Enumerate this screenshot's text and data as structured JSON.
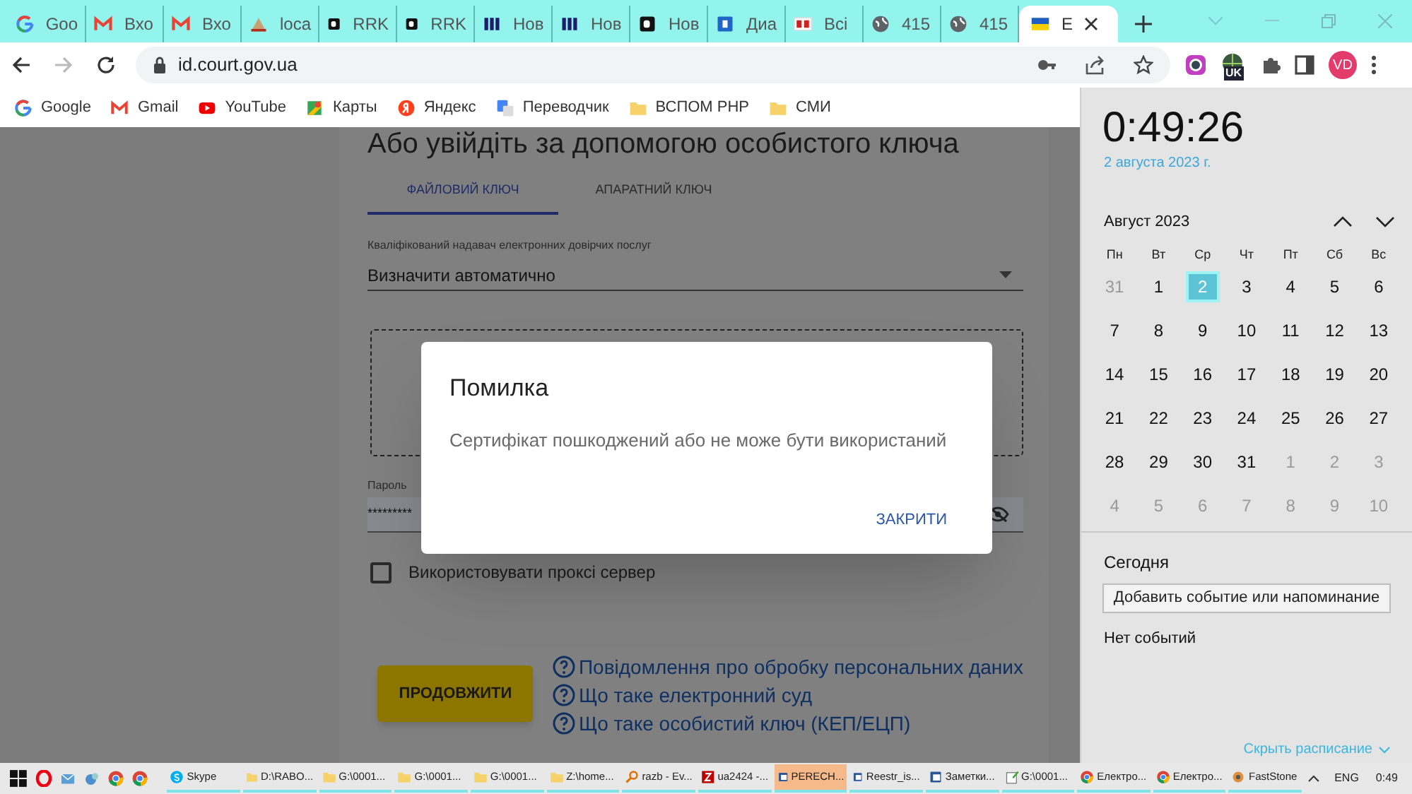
{
  "browser": {
    "tabs": [
      {
        "kind": "google",
        "title": "Goo",
        "selected": false
      },
      {
        "kind": "gmail",
        "title": "Вхо",
        "selected": false
      },
      {
        "kind": "gmail",
        "title": "Вхо",
        "selected": false
      },
      {
        "kind": "site",
        "title": "loca",
        "selected": false
      },
      {
        "kind": "dark",
        "title": "RRK",
        "selected": false
      },
      {
        "kind": "dark",
        "title": "RRK",
        "selected": false
      },
      {
        "kind": "navy",
        "title": "Нов",
        "selected": false
      },
      {
        "kind": "navy",
        "title": "Нов",
        "selected": false
      },
      {
        "kind": "dark",
        "title": "Нов",
        "selected": false
      },
      {
        "kind": "blue",
        "title": "Диа",
        "selected": false
      },
      {
        "kind": "red",
        "title": "Всі",
        "selected": false
      },
      {
        "kind": "globe",
        "title": "415",
        "selected": false
      },
      {
        "kind": "globe",
        "title": "415",
        "selected": false
      },
      {
        "kind": "flag",
        "title": "Е",
        "selected": true
      }
    ],
    "address": "id.court.gov.ua",
    "extension_badge": "UK",
    "profile": "VD",
    "bookmarks": [
      {
        "kind": "google",
        "label": "Google"
      },
      {
        "kind": "gmail",
        "label": "Gmail"
      },
      {
        "kind": "youtube",
        "label": "YouTube"
      },
      {
        "kind": "maps",
        "label": "Карты"
      },
      {
        "kind": "yandex",
        "label": "Яндекс"
      },
      {
        "kind": "translate",
        "label": "Переводчик"
      },
      {
        "kind": "folder",
        "label": "ВСПОМ РНР"
      },
      {
        "kind": "folder",
        "label": "СМИ"
      }
    ]
  },
  "page": {
    "heading": "Або увійдіть за допомогою особистого ключа",
    "tabs": [
      {
        "label": "ФАЙЛОВИЙ КЛЮЧ",
        "selected": true
      },
      {
        "label": "АПАРАТНИЙ КЛЮЧ",
        "selected": false
      }
    ],
    "provider_label": "Кваліфікований надавач електронних довірчих послуг",
    "provider_value": "Визначити автоматично",
    "password_label": "Пароль",
    "password_value": "*********",
    "proxy": {
      "label": "Використовувати проксі сервер",
      "checked": false
    },
    "continue_button": "ПРОДОВЖИТИ",
    "help_links": [
      "Повідомлення про обробку персональних даних",
      "Що таке електронний суд",
      "Що таке особистий ключ (КЕП/ЕЦП)"
    ]
  },
  "dialog": {
    "title": "Помилка",
    "message": "Сертифікат пошкоджений або не може бути використаний",
    "button": "ЗАКРИТИ"
  },
  "clock_panel": {
    "time": "0:49:26",
    "date": "2 августа 2023 г.",
    "month": "Август 2023",
    "weekdays": [
      "Пн",
      "Вт",
      "Ср",
      "Чт",
      "Пт",
      "Сб",
      "Вс"
    ],
    "days": [
      {
        "label": "31",
        "in_month": false,
        "selected": false
      },
      {
        "label": "1",
        "in_month": true,
        "selected": false
      },
      {
        "label": "2",
        "in_month": true,
        "selected": true
      },
      {
        "label": "3",
        "in_month": true,
        "selected": false
      },
      {
        "label": "4",
        "in_month": true,
        "selected": false
      },
      {
        "label": "5",
        "in_month": true,
        "selected": false
      },
      {
        "label": "6",
        "in_month": true,
        "selected": false
      },
      {
        "label": "7",
        "in_month": true,
        "selected": false
      },
      {
        "label": "8",
        "in_month": true,
        "selected": false
      },
      {
        "label": "9",
        "in_month": true,
        "selected": false
      },
      {
        "label": "10",
        "in_month": true,
        "selected": false
      },
      {
        "label": "11",
        "in_month": true,
        "selected": false
      },
      {
        "label": "12",
        "in_month": true,
        "selected": false
      },
      {
        "label": "13",
        "in_month": true,
        "selected": false
      },
      {
        "label": "14",
        "in_month": true,
        "selected": false
      },
      {
        "label": "15",
        "in_month": true,
        "selected": false
      },
      {
        "label": "16",
        "in_month": true,
        "selected": false
      },
      {
        "label": "17",
        "in_month": true,
        "selected": false
      },
      {
        "label": "18",
        "in_month": true,
        "selected": false
      },
      {
        "label": "19",
        "in_month": true,
        "selected": false
      },
      {
        "label": "20",
        "in_month": true,
        "selected": false
      },
      {
        "label": "21",
        "in_month": true,
        "selected": false
      },
      {
        "label": "22",
        "in_month": true,
        "selected": false
      },
      {
        "label": "23",
        "in_month": true,
        "selected": false
      },
      {
        "label": "24",
        "in_month": true,
        "selected": false
      },
      {
        "label": "25",
        "in_month": true,
        "selected": false
      },
      {
        "label": "26",
        "in_month": true,
        "selected": false
      },
      {
        "label": "27",
        "in_month": true,
        "selected": false
      },
      {
        "label": "28",
        "in_month": true,
        "selected": false
      },
      {
        "label": "29",
        "in_month": true,
        "selected": false
      },
      {
        "label": "30",
        "in_month": true,
        "selected": false
      },
      {
        "label": "31",
        "in_month": true,
        "selected": false
      },
      {
        "label": "1",
        "in_month": false,
        "selected": false
      },
      {
        "label": "2",
        "in_month": false,
        "selected": false
      },
      {
        "label": "3",
        "in_month": false,
        "selected": false
      },
      {
        "label": "4",
        "in_month": false,
        "selected": false
      },
      {
        "label": "5",
        "in_month": false,
        "selected": false
      },
      {
        "label": "6",
        "in_month": false,
        "selected": false
      },
      {
        "label": "7",
        "in_month": false,
        "selected": false
      },
      {
        "label": "8",
        "in_month": false,
        "selected": false
      },
      {
        "label": "9",
        "in_month": false,
        "selected": false
      },
      {
        "label": "10",
        "in_month": false,
        "selected": false
      }
    ],
    "today_heading": "Сегодня",
    "add_button": "Добавить событие или напоминание",
    "no_events": "Нет событий",
    "hide_link": "Скрыть расписание"
  },
  "taskbar": {
    "pinned": [
      {
        "kind": "opera"
      },
      {
        "kind": "mail"
      },
      {
        "kind": "app"
      },
      {
        "kind": "chrome"
      },
      {
        "kind": "chrome"
      }
    ],
    "items": [
      {
        "kind": "skype",
        "label": "Skype",
        "selected": false
      },
      {
        "kind": "folder",
        "label": "D:\\RABO...",
        "selected": false
      },
      {
        "kind": "folder",
        "label": "G:\\0001...",
        "selected": false
      },
      {
        "kind": "folder",
        "label": "G:\\0001...",
        "selected": false
      },
      {
        "kind": "folder",
        "label": "G:\\0001...",
        "selected": false
      },
      {
        "kind": "folder",
        "label": "Z:\\home...",
        "selected": false
      },
      {
        "kind": "search",
        "label": "razb - Ev...",
        "selected": false
      },
      {
        "kind": "filezilla",
        "label": "ua2424 -...",
        "selected": false
      },
      {
        "kind": "word",
        "label": "PERECH...",
        "selected": true
      },
      {
        "kind": "word",
        "label": "Reestr_is...",
        "selected": false
      },
      {
        "kind": "word",
        "label": "Заметки...",
        "selected": false
      },
      {
        "kind": "notepad",
        "label": "G:\\0001...",
        "selected": false
      },
      {
        "kind": "chrome",
        "label": "Електро...",
        "selected": false
      },
      {
        "kind": "chrome",
        "label": "Електро...",
        "selected": false
      },
      {
        "kind": "faststone",
        "label": "FastStone",
        "selected": false
      }
    ],
    "language": "ENG",
    "time": "0:49"
  }
}
